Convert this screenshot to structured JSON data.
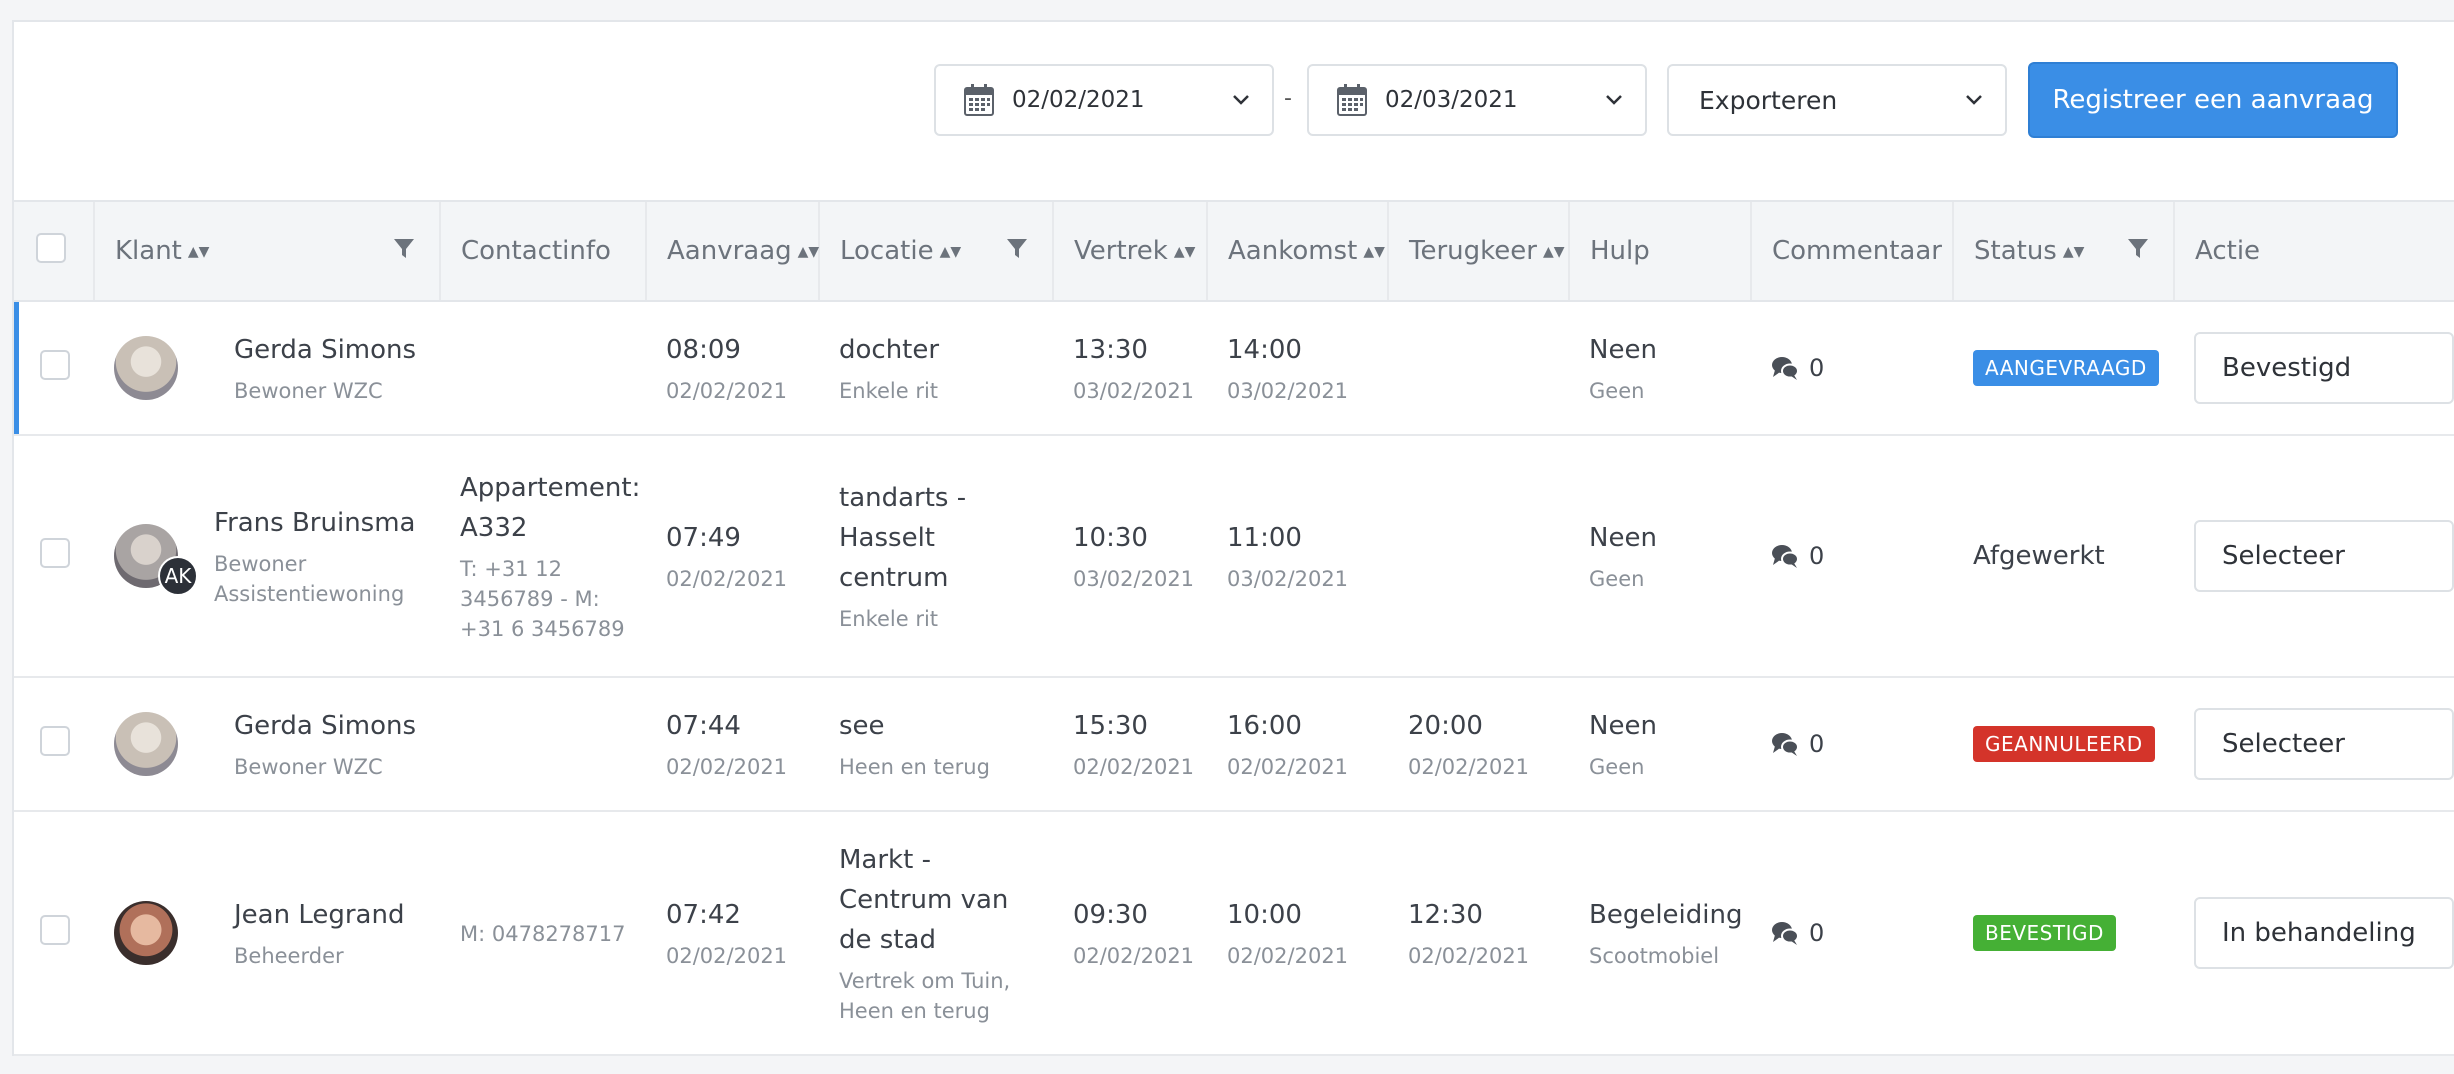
{
  "toolbar": {
    "date_from": "02/02/2021",
    "date_to": "02/03/2021",
    "separator": "-",
    "export_label": "Exporteren",
    "primary_button": "Registreer een aanvraag"
  },
  "colors": {
    "primary": "#3a8ee6",
    "badge_aangevraagd": "#3a8ee6",
    "badge_geannuleerd": "#d4342a",
    "badge_bevestigd": "#45b035"
  },
  "columns": [
    "Klant",
    "Contactinfo",
    "Aanvraag",
    "Locatie",
    "Vertrek",
    "Aankomst",
    "Terugkeer",
    "Hulp",
    "Commentaar",
    "Status",
    "Actie"
  ],
  "rows": [
    {
      "name": "Gerda Simons",
      "role": "Bewoner WZC",
      "contact": "",
      "aanvraag_time": "08:09",
      "aanvraag_date": "02/02/2021",
      "locatie": "dochter",
      "locatie_sub": "Enkele rit",
      "vertrek_time": "13:30",
      "vertrek_date": "03/02/2021",
      "aankomst_time": "14:00",
      "aankomst_date": "03/02/2021",
      "terugkeer_time": "",
      "terugkeer_date": "",
      "hulp": "Neen",
      "hulp_sub": "Geen",
      "comments": "0",
      "status": "AANGEVRAAGD",
      "action": "Bevestigd"
    },
    {
      "name": "Frans Bruinsma",
      "role": "Bewoner Assistentiewoning",
      "avatar_badge": "AK",
      "contact_title": "Appartement: A332",
      "contact": "T: +31 12 3456789 - M: +31 6 3456789",
      "aanvraag_time": "07:49",
      "aanvraag_date": "02/02/2021",
      "locatie": "tandarts - Hasselt centrum",
      "locatie_sub": "Enkele rit",
      "vertrek_time": "10:30",
      "vertrek_date": "03/02/2021",
      "aankomst_time": "11:00",
      "aankomst_date": "03/02/2021",
      "terugkeer_time": "",
      "terugkeer_date": "",
      "hulp": "Neen",
      "hulp_sub": "Geen",
      "comments": "0",
      "status": "Afgewerkt",
      "action": "Selecteer"
    },
    {
      "name": "Gerda Simons",
      "role": "Bewoner WZC",
      "contact": "",
      "aanvraag_time": "07:44",
      "aanvraag_date": "02/02/2021",
      "locatie": "see",
      "locatie_sub": "Heen en terug",
      "vertrek_time": "15:30",
      "vertrek_date": "02/02/2021",
      "aankomst_time": "16:00",
      "aankomst_date": "02/02/2021",
      "terugkeer_time": "20:00",
      "terugkeer_date": "02/02/2021",
      "hulp": "Neen",
      "hulp_sub": "Geen",
      "comments": "0",
      "status": "GEANNULEERD",
      "action": "Selecteer"
    },
    {
      "name": "Jean Legrand",
      "role": "Beheerder",
      "contact": "M: 0478278717",
      "aanvraag_time": "07:42",
      "aanvraag_date": "02/02/2021",
      "locatie": "Markt - Centrum van de stad",
      "locatie_sub": "Vertrek om Tuin, Heen en terug",
      "vertrek_time": "09:30",
      "vertrek_date": "02/02/2021",
      "aankomst_time": "10:00",
      "aankomst_date": "02/02/2021",
      "terugkeer_time": "12:30",
      "terugkeer_date": "02/02/2021",
      "hulp": "Begeleiding",
      "hulp_sub": "Scootmobiel",
      "comments": "0",
      "status": "BEVESTIGD",
      "action": "In behandeling"
    }
  ]
}
